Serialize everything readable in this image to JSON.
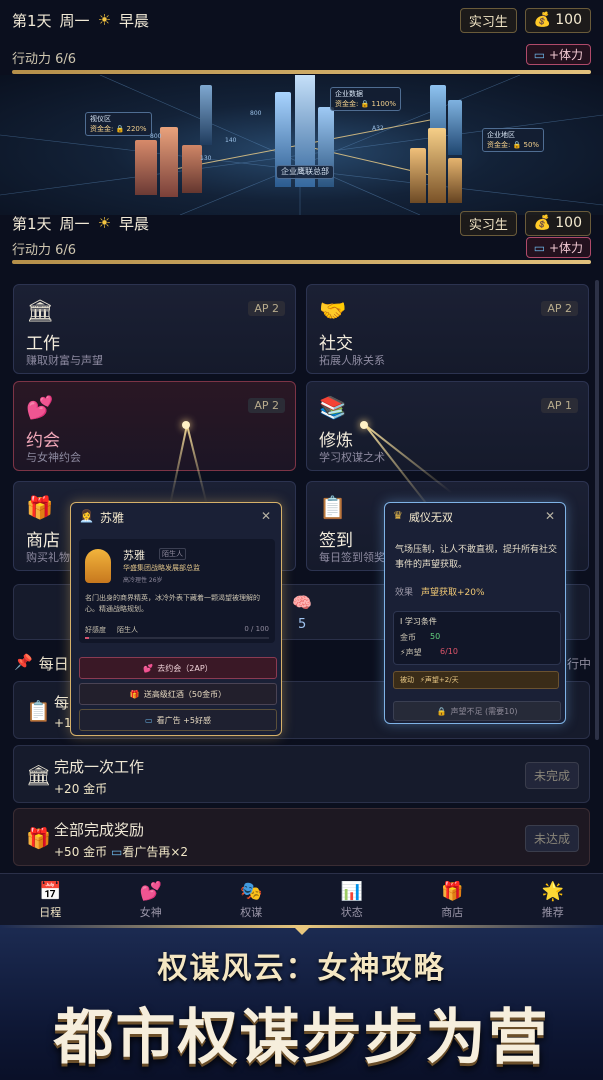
{
  "status_top": {
    "day": "第1天",
    "weekday": "周一",
    "period": "早晨",
    "rank": "实习生",
    "coins": "100",
    "action_label": "行动力 6/6",
    "stamina_button": "+体力",
    "action_fraction": 1.0
  },
  "status_mid": {
    "day": "第1天",
    "weekday": "周一",
    "period": "早晨",
    "rank": "实习生",
    "coins": "100",
    "action_label": "行动力 6/6",
    "stamina_button": "+体力",
    "action_fraction": 1.0
  },
  "map": {
    "hq_label": "企业鹰联总部",
    "labels": [
      {
        "title": "视仪区",
        "sub": "资金金: 🔒 220%"
      },
      {
        "title": "企业数据",
        "sub": "资金金: 🔒 1100%"
      },
      {
        "title": "企业地区",
        "sub": "资金金: 🔒 50%"
      }
    ],
    "road_numbers": [
      "800",
      "800",
      "130",
      "140",
      "A32"
    ]
  },
  "activities": [
    {
      "icon": "🏛",
      "title": "工作",
      "subtitle": "赚取财富与声望",
      "ap": "AP 2"
    },
    {
      "icon": "🤝",
      "title": "社交",
      "subtitle": "拓展人脉关系",
      "ap": "AP 2"
    },
    {
      "icon": "💕",
      "title": "约会",
      "subtitle": "与女神约会",
      "ap": "AP 2"
    },
    {
      "icon": "📚",
      "title": "修炼",
      "subtitle": "学习权谋之术",
      "ap": "AP 1"
    },
    {
      "icon": "🎁",
      "title": "商店",
      "subtitle": "购买礼物",
      "ap": ""
    },
    {
      "icon": "📋",
      "title": "签到",
      "subtitle": "每日签到领奖",
      "ap": ""
    }
  ],
  "stat_strip": {
    "value": "5",
    "icon": "🧠"
  },
  "daily": {
    "header": "每日",
    "right": "行中"
  },
  "tasks": [
    {
      "icon": "📋",
      "title": "每",
      "reward": "+15"
    },
    {
      "icon": "🏛",
      "title": "完成一次工作",
      "reward": "+20 金币",
      "button": "未完成"
    },
    {
      "icon": "🎁",
      "title": "全部完成奖励",
      "reward": "+50 金币",
      "reward2": "看广告再×2",
      "button": "未达成"
    }
  ],
  "popup_left": {
    "title": "苏雅",
    "name": "苏雅",
    "tag": "陌生人",
    "desc": "华盛集团战略发展部总监",
    "meta": "高冷理性 26岁",
    "quote": "名门出身的商界精英，冰冷外表下藏着一颗渴望被理解的心。精通战略规划。",
    "favor_label": "好感度",
    "favor_state": "陌生人",
    "favor_value": "0 / 100",
    "favor_fraction": 0.0,
    "btn1": "去约会（2AP）",
    "btn2": "送高级红酒（50金币）",
    "btn3": "看广告 +5好感"
  },
  "popup_right": {
    "title": "威仪无双",
    "desc": "气场压制，让人不敢直视，提升所有社交事件的声望获取。",
    "effect_label": "效果",
    "effect_value": "声望获取+20%",
    "cond_title": "I 学习条件",
    "cond_coin_label": "金币",
    "cond_coin_value": "50",
    "cond_rep_label": "⚡声望",
    "cond_rep_value": "6/10",
    "bonus_label": "被动",
    "bonus_value": "⚡声望+2/天",
    "locked": "声望不足 (需要10)"
  },
  "nav": [
    {
      "icon": "📅",
      "label": "日程",
      "active": true
    },
    {
      "icon": "💕",
      "label": "女神",
      "active": false
    },
    {
      "icon": "🎭",
      "label": "权谋",
      "active": false
    },
    {
      "icon": "📊",
      "label": "状态",
      "active": false
    },
    {
      "icon": "🎁",
      "label": "商店",
      "active": false
    },
    {
      "icon": "🌟",
      "label": "推荐",
      "active": false
    }
  ],
  "banner": {
    "subtitle": "权谋风云：女神攻略",
    "title": "都市权谋步步为营"
  },
  "colors": {
    "gold": "#e2c17d",
    "pink": "#c0506f",
    "navy": "#151a2b"
  }
}
